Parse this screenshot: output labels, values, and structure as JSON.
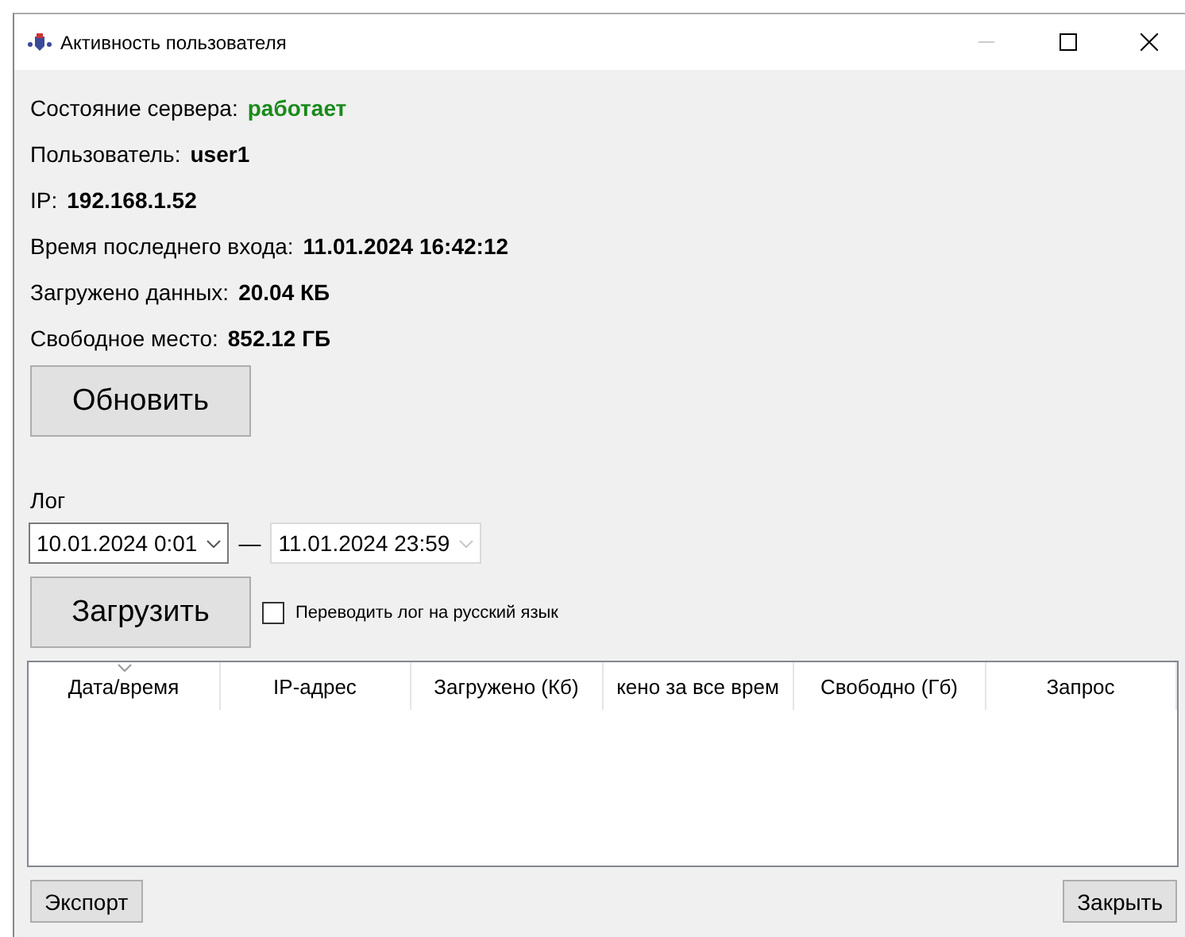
{
  "window": {
    "title": "Активность пользователя"
  },
  "info": [
    {
      "label": "Состояние сервера:",
      "value": "работает",
      "kind": "status"
    },
    {
      "label": "Пользователь:",
      "value": "user1",
      "kind": "value"
    },
    {
      "label": "IP:",
      "value": "192.168.1.52",
      "kind": "value"
    },
    {
      "label": "Время последнего входа:",
      "value": "11.01.2024 16:42:12",
      "kind": "value"
    },
    {
      "label": "Загружено данных:",
      "value": "20.04 КБ",
      "kind": "value"
    },
    {
      "label": "Свободное место:",
      "value": "852.12 ГБ",
      "kind": "value"
    }
  ],
  "refresh_button": "Обновить",
  "log": {
    "label": "Лог",
    "from": {
      "value": "10.01.2024 0:01",
      "disabled": false
    },
    "separator": "—",
    "to": {
      "value": "11.01.2024 23:59",
      "disabled": true
    },
    "load_button": "Загрузить",
    "translate": {
      "label": "Переводить лог на русский язык",
      "checked": false
    }
  },
  "table": {
    "columns": [
      {
        "label": "Дата/время",
        "sorted": true
      },
      {
        "label": "IP-адрес",
        "sorted": false
      },
      {
        "label": "Загружено (Кб)",
        "sorted": false
      },
      {
        "label": "кено за все врем",
        "sorted": false
      },
      {
        "label": "Свободно (Гб)",
        "sorted": false
      },
      {
        "label": "Запрос",
        "sorted": false
      }
    ]
  },
  "buttons": {
    "export": "Экспорт",
    "close": "Закрыть"
  }
}
